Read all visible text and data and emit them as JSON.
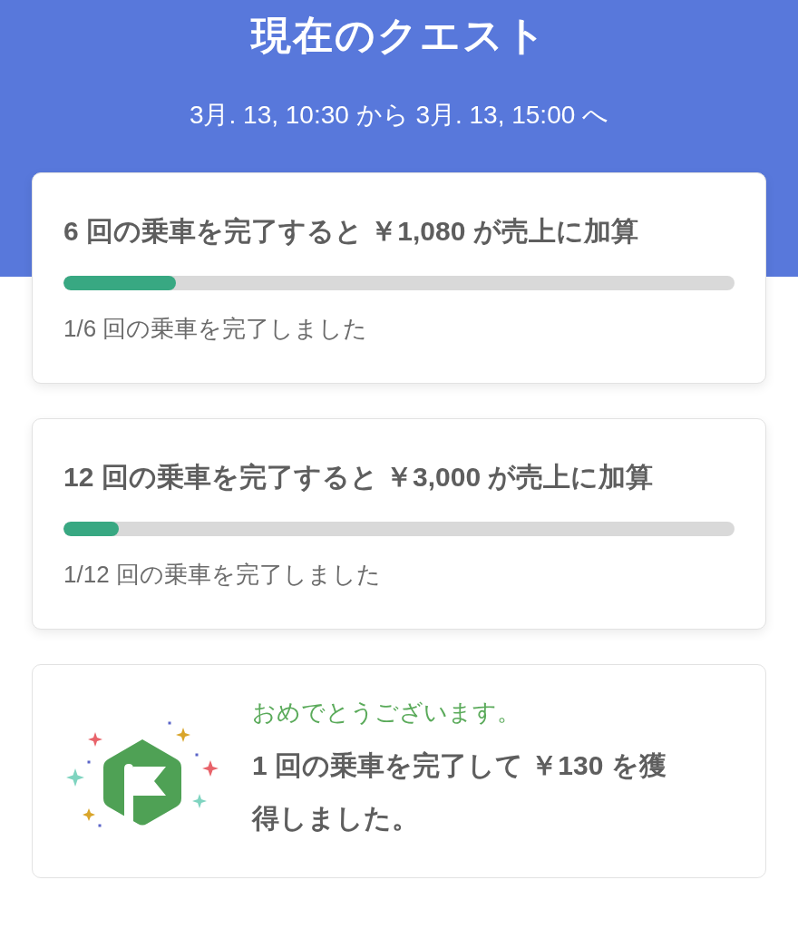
{
  "header": {
    "title": "現在のクエスト",
    "period": "3月. 13, 10:30 から 3月. 13, 15:00 へ"
  },
  "quests": [
    {
      "title": "6 回の乗車を完了すると ￥1,080 が売上に加算",
      "level": 0.167,
      "progress_text": "1/6 回の乗車を完了しました"
    },
    {
      "title": "12 回の乗車を完了すると ￥3,000 が売上に加算",
      "level": 0.083,
      "progress_text": "1/12 回の乗車を完了しました"
    }
  ],
  "achievement": {
    "greeting": "おめでとうございます。",
    "message": "1 回の乗車を完了して ￥130 を獲得しました。"
  }
}
